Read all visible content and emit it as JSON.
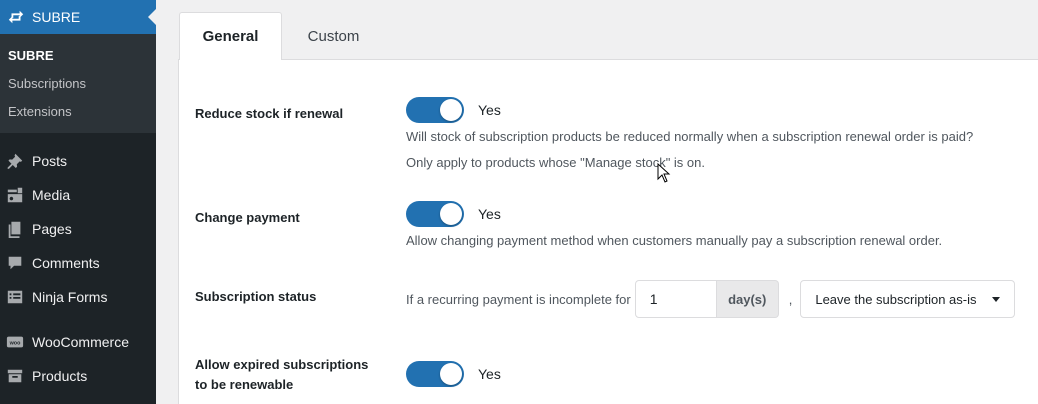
{
  "sidebar": {
    "active_menu": {
      "label": "SUBRE",
      "icon": "repeat-icon"
    },
    "submenu": [
      {
        "label": "SUBRE",
        "current": true
      },
      {
        "label": "Subscriptions"
      },
      {
        "label": "Extensions"
      }
    ],
    "items": [
      {
        "label": "Posts",
        "icon": "pushpin-icon"
      },
      {
        "label": "Media",
        "icon": "media-icon"
      },
      {
        "label": "Pages",
        "icon": "pages-icon"
      },
      {
        "label": "Comments",
        "icon": "comments-icon"
      },
      {
        "label": "Ninja Forms",
        "icon": "form-icon"
      },
      {
        "label": "WooCommerce",
        "icon": "woo-icon"
      },
      {
        "label": "Products",
        "icon": "archive-icon"
      }
    ]
  },
  "tabs": [
    {
      "label": "General",
      "active": true
    },
    {
      "label": "Custom",
      "active": false
    }
  ],
  "settings": {
    "reduce_stock": {
      "label": "Reduce stock if renewal",
      "toggle_text": "Yes",
      "enabled": true,
      "desc1": "Will stock of subscription products be reduced normally when a subscription renewal order is paid?",
      "desc2": "Only apply to products whose \"Manage stock\" is on."
    },
    "change_payment": {
      "label": "Change payment",
      "toggle_text": "Yes",
      "enabled": true,
      "desc": "Allow changing payment method when customers manually pay a subscription renewal order."
    },
    "subscription_status": {
      "label": "Subscription status",
      "prefix": "If a recurring payment is incomplete for",
      "days_value": "1",
      "unit": "day(s)",
      "separator": ",",
      "action_selected": "Leave the subscription as-is"
    },
    "allow_expired": {
      "label_line1": "Allow expired subscriptions",
      "label_line2": "to be renewable",
      "toggle_text": "Yes",
      "enabled": true
    }
  },
  "colors": {
    "accent": "#2271b1",
    "sidebar_bg": "#1d2327",
    "submenu_bg": "#2c3338"
  }
}
